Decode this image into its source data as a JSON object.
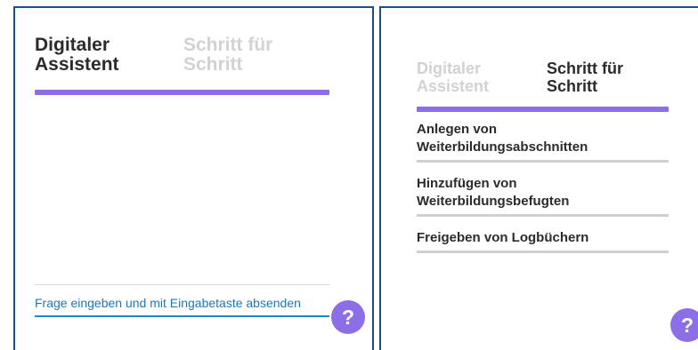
{
  "left_panel": {
    "tabs": [
      {
        "label": "Digitaler\nAssistent",
        "active": true
      },
      {
        "label": "Schritt für\nSchritt",
        "active": false
      }
    ],
    "question_input": {
      "placeholder": "Frage eingeben und mit Eingabetaste absenden"
    },
    "help_label": "?"
  },
  "right_panel": {
    "tabs": [
      {
        "label": "Digitaler\nAssistent",
        "active": false
      },
      {
        "label": "Schritt für\nSchritt",
        "active": true
      }
    ],
    "steps": [
      {
        "label": "Anlegen von\nWeiterbildungsabschnitten"
      },
      {
        "label": "Hinzufügen von\nWeiterbildungsbefugten"
      },
      {
        "label": "Freigeben von Logbüchern"
      }
    ],
    "help_label": "?"
  },
  "colors": {
    "accent": "#8c6ee6",
    "frame": "#1d4e86",
    "link": "#1e78b8",
    "inactive_text": "#d2d2d2"
  }
}
